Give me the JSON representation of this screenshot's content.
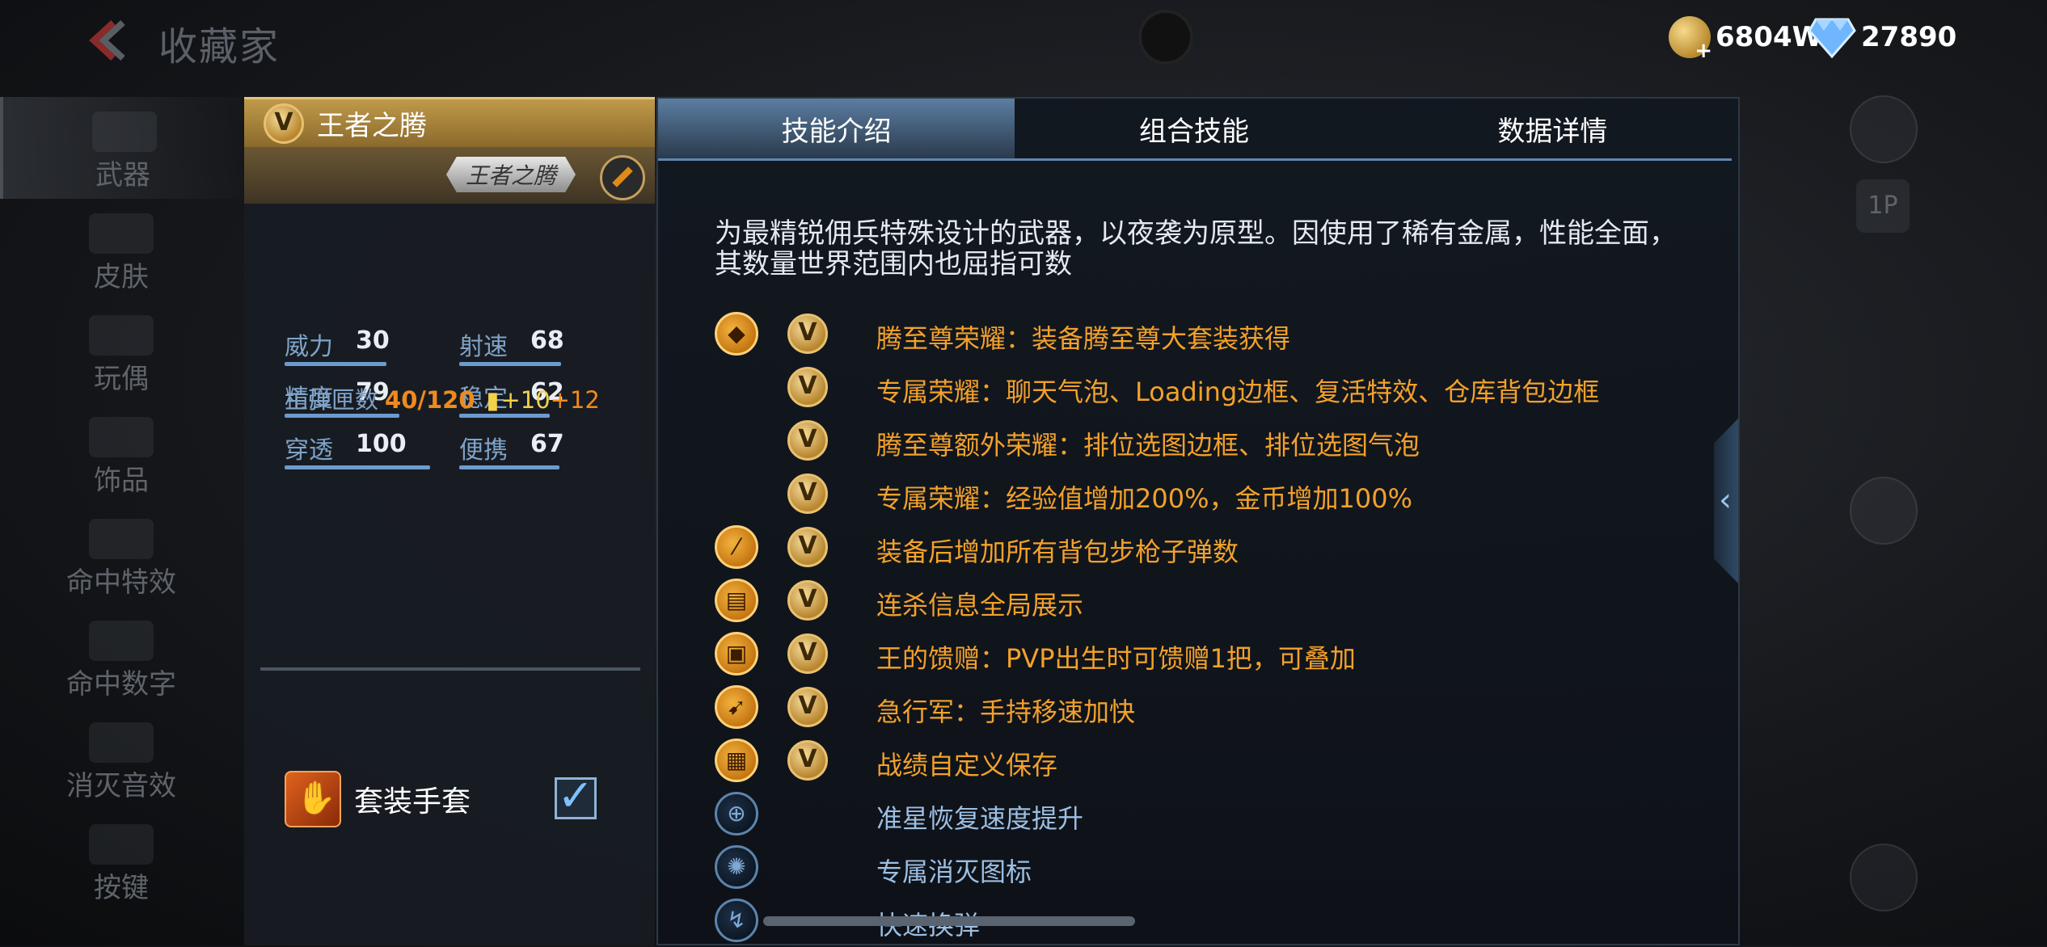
{
  "header": {
    "title": "收藏家",
    "gold_amount": "6804W",
    "gem_amount": "27890"
  },
  "nav": {
    "items": [
      {
        "label": "武器",
        "active": true
      },
      {
        "label": "皮肤"
      },
      {
        "label": "玩偶"
      },
      {
        "label": "饰品"
      },
      {
        "label": "命中特效"
      },
      {
        "label": "命中数字"
      },
      {
        "label": "消灭音效"
      },
      {
        "label": "按键"
      }
    ]
  },
  "weapon": {
    "name": "王者之腾",
    "plate_name": "王者之腾",
    "stats": [
      {
        "label": "威力",
        "value": "30"
      },
      {
        "label": "射速",
        "value": "68"
      },
      {
        "label": "精度",
        "value": "79"
      },
      {
        "label": "稳定",
        "value": "62"
      },
      {
        "label": "穿透",
        "value": "100"
      },
      {
        "label": "便携",
        "value": "67"
      }
    ],
    "ammo_label": "主弹匣数",
    "ammo_value": "40/120",
    "ammo_bonus1": "+10",
    "ammo_bonus2": "+12",
    "suit_label": "套装手套",
    "suit_checked": true
  },
  "tabs": [
    "技能介绍",
    "组合技能",
    "数据详情"
  ],
  "description": "为最精锐佣兵特殊设计的武器，以夜袭为原型。因使用了稀有金属，性能全面，其数量世界范围内也屈指可数",
  "skills": [
    {
      "text": "腾至尊荣耀：装备腾至尊大套装获得",
      "icon": "diamond-icon",
      "v_icon": "v-badge-icon",
      "style": "gold"
    },
    {
      "text": "专属荣耀：聊天气泡、Loading边框、复活特效、仓库背包边框",
      "icon": null,
      "v_icon": "v-badge-icon",
      "style": "gold"
    },
    {
      "text": "腾至尊额外荣耀：排位选图边框、排位选图气泡",
      "icon": null,
      "v_icon": "v-badge-icon",
      "style": "gold"
    },
    {
      "text": "专属荣耀：经验值增加200%，金币增加100%",
      "icon": null,
      "v_icon": "v-badge-icon",
      "style": "gold"
    },
    {
      "text": "装备后增加所有背包步枪子弹数",
      "icon": "rifle-icon",
      "v_icon": "v-badge-icon",
      "style": "gold"
    },
    {
      "text": "连杀信息全局展示",
      "icon": "killstreak-icon",
      "v_icon": "v-badge-icon",
      "style": "gold"
    },
    {
      "text": "王的馈赠：PVP出生时可馈赠1把，可叠加",
      "icon": "gift-icon",
      "v_icon": "v-badge-icon",
      "style": "gold"
    },
    {
      "text": "急行军：手持移速加快",
      "icon": "running-icon",
      "v_icon": "v-badge-icon",
      "style": "gold"
    },
    {
      "text": "战绩自定义保存",
      "icon": "record-icon",
      "v_icon": "v-badge-icon",
      "style": "gold"
    },
    {
      "text": "准星恢复速度提升",
      "icon": "crosshair-icon",
      "v_icon": null,
      "style": "blue"
    },
    {
      "text": "专属消灭图标",
      "icon": "kill-emblem-icon",
      "v_icon": null,
      "style": "blue"
    },
    {
      "text": "快速换弹",
      "icon": "reload-icon",
      "v_icon": null,
      "style": "blue"
    }
  ],
  "colors": {
    "gold_text": "#f3a12b",
    "blue_text": "#9cbfe3",
    "accent_blue": "#5f87ad"
  }
}
